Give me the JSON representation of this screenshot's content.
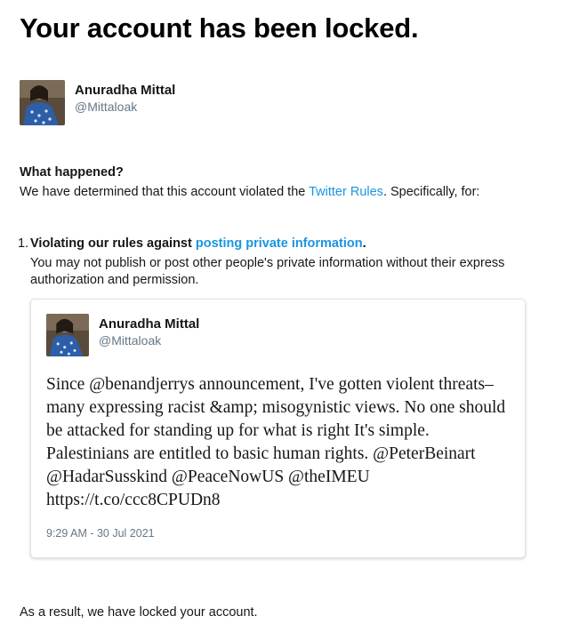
{
  "page": {
    "title": "Your account has been locked."
  },
  "account": {
    "name": "Anuradha Mittal",
    "handle": "@Mittaloak"
  },
  "what_happened": {
    "heading": "What happened?",
    "text_before": "We have determined that this account violated the ",
    "rules_link": "Twitter Rules",
    "text_after": ". Specifically, for:"
  },
  "violation": {
    "number": "1.",
    "title_before": "Violating our rules against ",
    "title_link": "posting private information",
    "title_after": ".",
    "description": "You may not publish or post other people's private information without their express authorization and permission."
  },
  "tweet": {
    "author_name": "Anuradha Mittal",
    "author_handle": "@Mittaloak",
    "text": "Since @benandjerrys announcement, I've gotten violent threats–many expressing racist &amp; misogynistic views. No one should be attacked for standing up for what is right It's simple. Palestinians are entitled to basic human rights. @PeterBeinart @HadarSusskind @PeaceNowUS @theIMEU https://t.co/ccc8CPUDn8",
    "timestamp": "9:29 AM - 30 Jul 2021"
  },
  "result": {
    "text": "As a result, we have locked your account."
  },
  "colors": {
    "link": "#1b95e0",
    "muted": "#657786",
    "text": "#14171a"
  }
}
